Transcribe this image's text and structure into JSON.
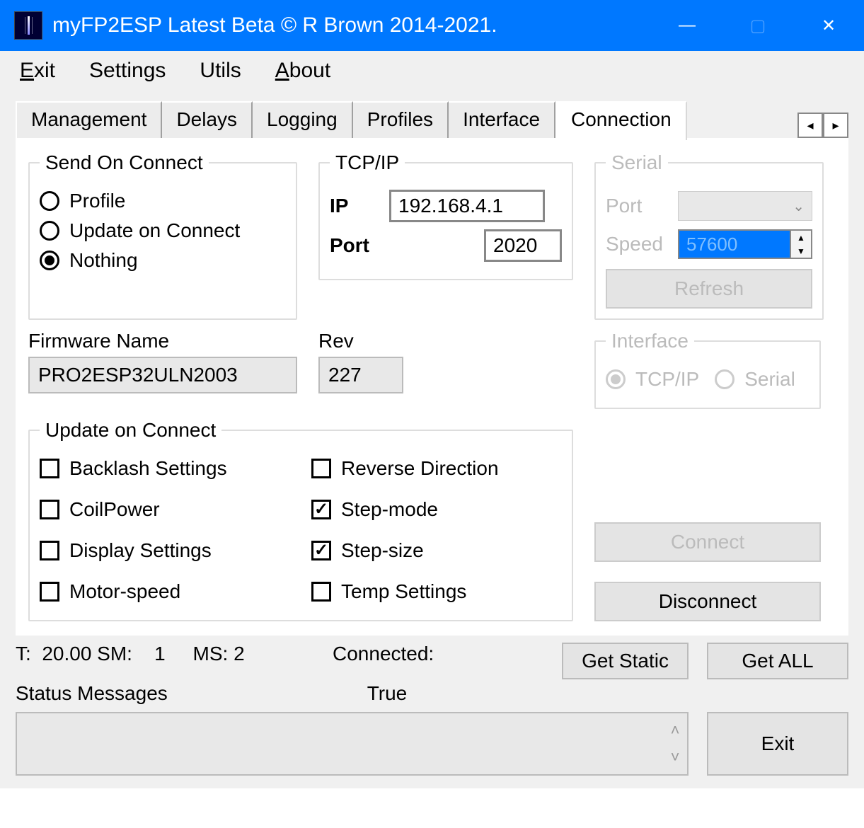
{
  "title": "myFP2ESP Latest Beta © R Brown 2014-2021.",
  "menu": {
    "exit": "Exit",
    "settings": "Settings",
    "utils": "Utils",
    "about": "About"
  },
  "tabs": {
    "management": "Management",
    "delays": "Delays",
    "logging": "Logging",
    "profiles": "Profiles",
    "iface": "Interface",
    "connection": "Connection"
  },
  "send_on_connect": {
    "legend": "Send On Connect",
    "profile": "Profile",
    "update": "Update on Connect",
    "nothing": "Nothing"
  },
  "tcpip": {
    "legend": "TCP/IP",
    "ip_label": "IP",
    "ip_value": "192.168.4.1",
    "port_label": "Port",
    "port_value": "2020"
  },
  "serial": {
    "legend": "Serial",
    "port_label": "Port",
    "speed_label": "Speed",
    "speed_value": "57600",
    "refresh": "Refresh"
  },
  "firmware": {
    "label": "Firmware Name",
    "value": "PRO2ESP32ULN2003",
    "rev_label": "Rev",
    "rev_value": "227"
  },
  "update": {
    "legend": "Update on Connect",
    "backlash": "Backlash Settings",
    "coil": "CoilPower",
    "display": "Display Settings",
    "motor": "Motor-speed",
    "reverse": "Reverse Direction",
    "stepmode": "Step-mode",
    "stepsize": "Step-size",
    "temp": "Temp Settings"
  },
  "interface": {
    "legend": "Interface",
    "tcpip": "TCP/IP",
    "serial": "Serial"
  },
  "buttons": {
    "connect": "Connect",
    "disconnect": "Disconnect",
    "get_static": "Get Static",
    "get_all": "Get ALL",
    "exit": "Exit"
  },
  "status": {
    "line": "T:  20.00 SM:    1     MS: 2",
    "connected_label": "Connected:",
    "messages_label": "Status Messages",
    "connected_value": "True"
  }
}
